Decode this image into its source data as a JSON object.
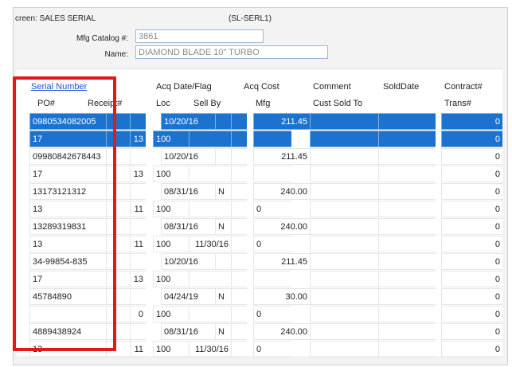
{
  "screen": {
    "title": "creen: SALES SERIAL",
    "code": "(SL-SERL1)"
  },
  "form": {
    "catalog_label": "Mfg Catalog #:",
    "catalog_value": "3861",
    "name_label": "Name:",
    "name_value": "DIAMOND BLADE 10\" TURBO"
  },
  "grid": {
    "headers_top": {
      "serial": "Serial Number",
      "acq_date_flag": "Acq Date/Flag",
      "acq_cost": "Acq Cost",
      "comment": "Comment",
      "sold_date": "SoldDate",
      "contract": "Contract#"
    },
    "headers_bottom": {
      "po": "PO#",
      "receipt": "Receipt#",
      "loc": "Loc",
      "sell_by": "Sell By",
      "mfg": "Mfg",
      "cust_sold_to": "Cust Sold To",
      "trans": "Trans#"
    },
    "records": [
      {
        "serial": "0980534082005",
        "date": "10/20/16",
        "flag": "",
        "cost": "211.45",
        "po": "17",
        "receipt": "13",
        "loc": "100",
        "sellby": "",
        "mfg": "",
        "contract": "0",
        "trans": "0",
        "selected": true
      },
      {
        "serial": "09980842678443",
        "date": "10/20/16",
        "flag": "",
        "cost": "211.45",
        "po": "17",
        "receipt": "13",
        "loc": "100",
        "sellby": "",
        "mfg": "",
        "contract": "0",
        "trans": "0",
        "selected": false
      },
      {
        "serial": "13173121312",
        "date": "08/31/16",
        "flag": "N",
        "cost": "240.00",
        "po": "13",
        "receipt": "11",
        "loc": "100",
        "sellby": "",
        "mfg": "0",
        "contract": "0",
        "trans": "0",
        "selected": false
      },
      {
        "serial": "13289319831",
        "date": "08/31/16",
        "flag": "N",
        "cost": "240.00",
        "po": "13",
        "receipt": "11",
        "loc": "100",
        "sellby": "11/30/16",
        "mfg": "0",
        "contract": "0",
        "trans": "0",
        "selected": false
      },
      {
        "serial": "34-99854-835",
        "date": "10/20/16",
        "flag": "",
        "cost": "211.45",
        "po": "17",
        "receipt": "13",
        "loc": "100",
        "sellby": "",
        "mfg": "",
        "contract": "0",
        "trans": "0",
        "selected": false
      },
      {
        "serial": "45784890",
        "date": "04/24/19",
        "flag": "N",
        "cost": "30.00",
        "po": "",
        "receipt": "0",
        "loc": "100",
        "sellby": "",
        "mfg": "0",
        "contract": "0",
        "trans": "0",
        "selected": false
      },
      {
        "serial": "4889438924",
        "date": "08/31/16",
        "flag": "N",
        "cost": "240.00",
        "po": "13",
        "receipt": "11",
        "loc": "100",
        "sellby": "11/30/16",
        "mfg": "0",
        "contract": "0",
        "trans": "0",
        "selected": false
      }
    ]
  },
  "colors": {
    "selection": "#1b73cf",
    "highlight_box": "#e01919",
    "link": "#1b4fd6"
  }
}
